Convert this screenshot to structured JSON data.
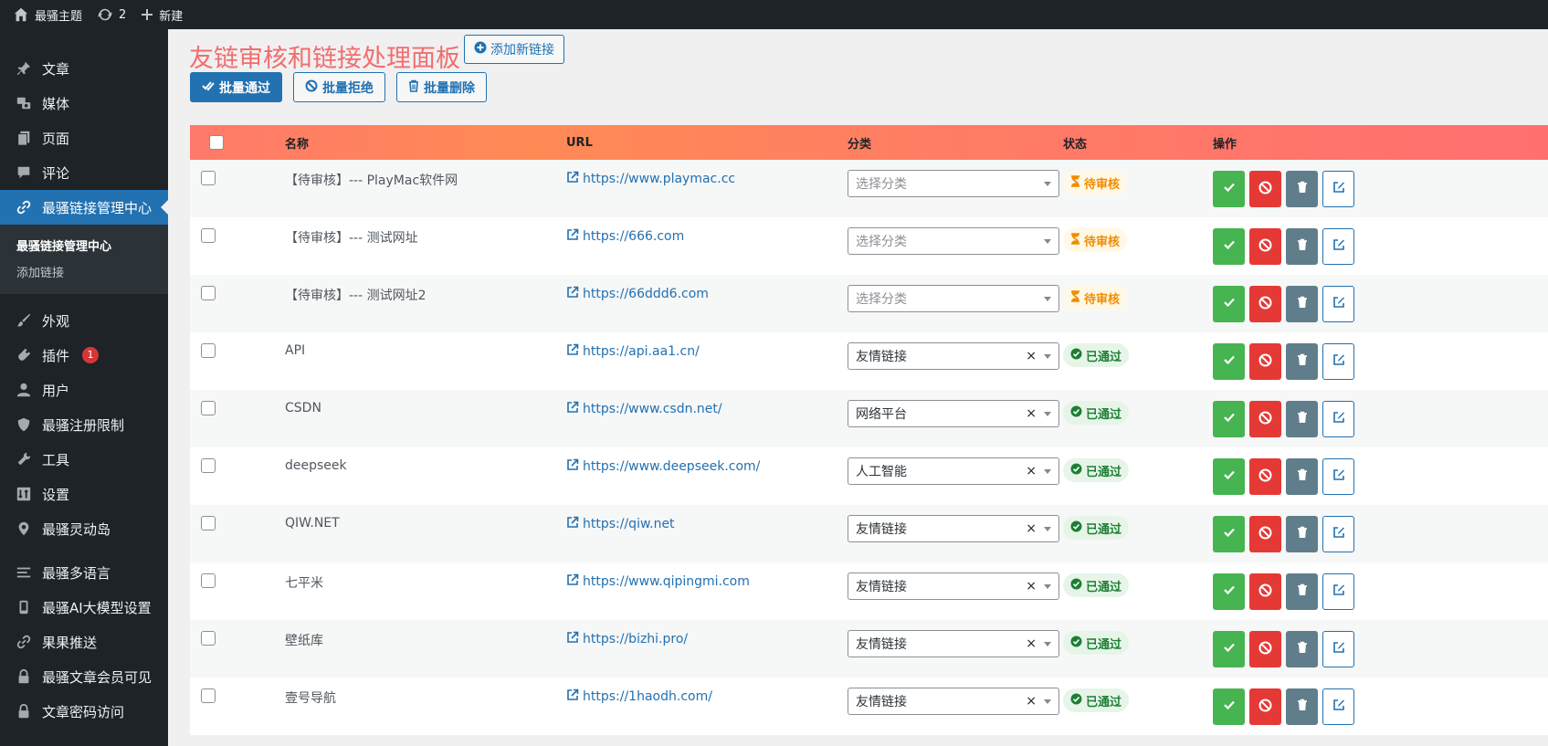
{
  "adminbar": {
    "site_name": "最骚主题",
    "updates_count": "2",
    "new_label": "新建"
  },
  "menu": {
    "items_top": [
      {
        "label": "文章",
        "icon": "pin-icon"
      },
      {
        "label": "媒体",
        "icon": "media-icon"
      },
      {
        "label": "页面",
        "icon": "page-icon"
      },
      {
        "label": "评论",
        "icon": "comment-icon"
      },
      {
        "label": "最骚链接管理中心",
        "icon": "link-icon"
      }
    ],
    "submenu": [
      "最骚链接管理中心",
      "添加链接"
    ],
    "items_bottom": [
      {
        "label": "外观",
        "icon": "brush-icon"
      },
      {
        "label": "插件",
        "icon": "plugin-icon",
        "badge": "1"
      },
      {
        "label": "用户",
        "icon": "user-icon"
      },
      {
        "label": "最骚注册限制",
        "icon": "shield-icon"
      },
      {
        "label": "工具",
        "icon": "wrench-icon"
      },
      {
        "label": "设置",
        "icon": "settings-icon"
      },
      {
        "label": "最骚灵动岛",
        "icon": "location-icon"
      }
    ],
    "items_extra": [
      {
        "label": "最骚多语言",
        "icon": "list-icon"
      },
      {
        "label": "最骚AI大模型设置",
        "icon": "device-icon"
      },
      {
        "label": "果果推送",
        "icon": "link-icon"
      },
      {
        "label": "最骚文章会员可见",
        "icon": "lock-icon"
      },
      {
        "label": "文章密码访问",
        "icon": "lock-icon"
      }
    ]
  },
  "page": {
    "title": "友链审核和链接处理面板",
    "add_button": "添加新链接",
    "bulk": {
      "approve": "批量通过",
      "reject": "批量拒绝",
      "delete": "批量删除"
    }
  },
  "table": {
    "headers": {
      "name": "名称",
      "url": "URL",
      "category": "分类",
      "status": "状态",
      "actions": "操作"
    },
    "rows": [
      {
        "name": "【待审核】--- PlayMac软件网",
        "url": "https://www.playmac.cc",
        "category": "选择分类",
        "placeholder": true,
        "status": "待审核",
        "state": "pending"
      },
      {
        "name": "【待审核】--- 测试网址",
        "url": "https://666.com",
        "category": "选择分类",
        "placeholder": true,
        "status": "待审核",
        "state": "pending"
      },
      {
        "name": "【待审核】--- 测试网址2",
        "url": "https://66ddd6.com",
        "category": "选择分类",
        "placeholder": true,
        "status": "待审核",
        "state": "pending"
      },
      {
        "name": "API",
        "url": "https://api.aa1.cn/",
        "category": "友情链接",
        "placeholder": false,
        "status": "已通过",
        "state": "approved"
      },
      {
        "name": "CSDN",
        "url": "https://www.csdn.net/",
        "category": "网络平台",
        "placeholder": false,
        "status": "已通过",
        "state": "approved"
      },
      {
        "name": "deepseek",
        "url": "https://www.deepseek.com/",
        "category": "人工智能",
        "placeholder": false,
        "status": "已通过",
        "state": "approved"
      },
      {
        "name": "QIW.NET",
        "url": "https://qiw.net",
        "category": "友情链接",
        "placeholder": false,
        "status": "已通过",
        "state": "approved"
      },
      {
        "name": "七平米",
        "url": "https://www.qipingmi.com",
        "category": "友情链接",
        "placeholder": false,
        "status": "已通过",
        "state": "approved"
      },
      {
        "name": "壁纸库",
        "url": "https://bizhi.pro/",
        "category": "友情链接",
        "placeholder": false,
        "status": "已通过",
        "state": "approved"
      },
      {
        "name": "壹号导航",
        "url": "https://1haodh.com/",
        "category": "友情链接",
        "placeholder": false,
        "status": "已通过",
        "state": "approved"
      }
    ]
  },
  "colors": {
    "accent": "#2271b1",
    "title": "#f26d6d",
    "approve": "#46b450",
    "reject": "#e53935",
    "delete": "#607d8b"
  }
}
